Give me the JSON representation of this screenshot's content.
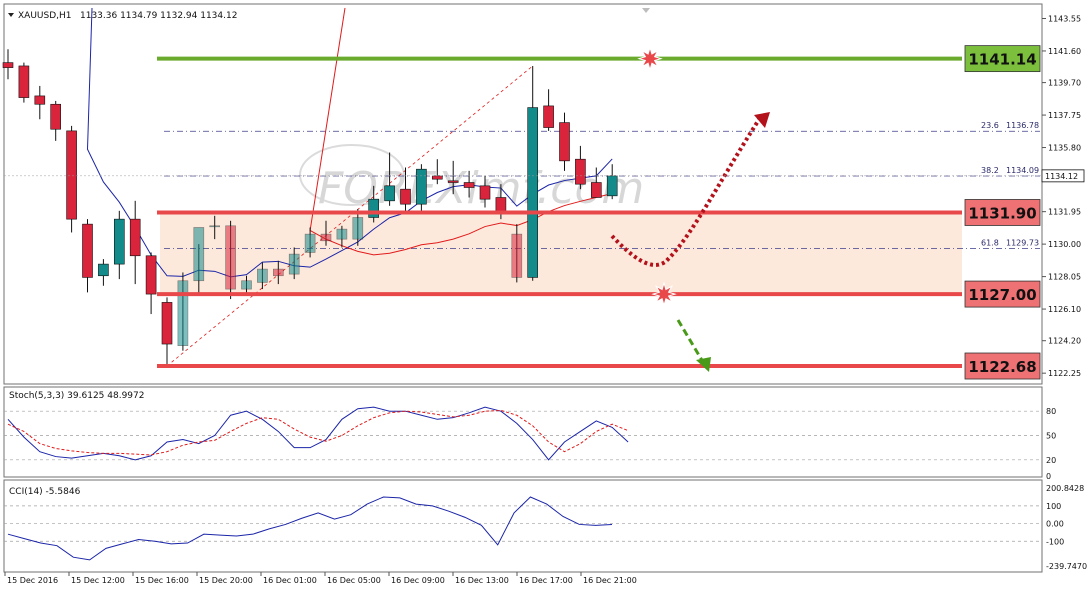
{
  "header": {
    "symbol": "XAUUSD,H1",
    "ohlc": "1133.36 1134.79 1132.94 1134.12"
  },
  "watermark": "FOREXimf.com",
  "colors": {
    "bull_candle": "#138b8b",
    "bear_candle": "#d9243c",
    "resistance_green": "#6aab2e",
    "support_red": "#e8484a",
    "zone_fill": "#fde9dc",
    "ma_blue": "#1b25a8",
    "ma_red": "#e11b1b",
    "stoch_main": "#1b25a8",
    "stoch_signal": "#e11b1b",
    "cci_line": "#1b25a8",
    "arrow_up": "#b3121b",
    "arrow_down": "#4a9a1a"
  },
  "chart_data": [
    {
      "type": "candlestick",
      "title": "XAUUSD,H1",
      "ohlc_last": [
        1133.36,
        1134.79,
        1132.94,
        1134.12
      ],
      "current_price_label": "1134.12",
      "ylim": [
        1121.6,
        1144.3
      ],
      "y_ticks": [
        "1143.55",
        "1141.60",
        "1139.70",
        "1137.75",
        "1135.80",
        "1133.90",
        "1131.95",
        "1130.00",
        "1128.05",
        "1126.10",
        "1124.20",
        "1122.25"
      ],
      "x_ticks": [
        "15 Dec 2016",
        "15 Dec 12:00",
        "15 Dec 16:00",
        "15 Dec 20:00",
        "16 Dec 01:00",
        "16 Dec 05:00",
        "16 Dec 09:00",
        "16 Dec 13:00",
        "16 Dec 17:00",
        "16 Dec 21:00"
      ],
      "candles": [
        {
          "o": 1140.9,
          "h": 1141.7,
          "l": 1139.9,
          "c": 1140.6
        },
        {
          "o": 1140.7,
          "h": 1140.9,
          "l": 1138.5,
          "c": 1138.8
        },
        {
          "o": 1138.9,
          "h": 1139.5,
          "l": 1137.5,
          "c": 1138.4
        },
        {
          "o": 1138.4,
          "h": 1138.6,
          "l": 1136.2,
          "c": 1136.9
        },
        {
          "o": 1136.8,
          "h": 1137.1,
          "l": 1130.7,
          "c": 1131.5
        },
        {
          "o": 1131.2,
          "h": 1131.5,
          "l": 1127.1,
          "c": 1128.0
        },
        {
          "o": 1128.1,
          "h": 1129.1,
          "l": 1127.5,
          "c": 1128.8
        },
        {
          "o": 1128.8,
          "h": 1132.0,
          "l": 1127.9,
          "c": 1131.5
        },
        {
          "o": 1131.5,
          "h": 1132.6,
          "l": 1127.6,
          "c": 1129.3
        },
        {
          "o": 1129.3,
          "h": 1129.5,
          "l": 1125.8,
          "c": 1127.0
        },
        {
          "o": 1126.5,
          "h": 1126.8,
          "l": 1122.7,
          "c": 1124.0
        },
        {
          "o": 1123.9,
          "h": 1128.3,
          "l": 1123.6,
          "c": 1127.8
        },
        {
          "o": 1127.8,
          "h": 1130.0,
          "l": 1126.9,
          "c": 1131.0
        },
        {
          "o": 1131.1,
          "h": 1131.7,
          "l": 1130.3,
          "c": 1131.1
        },
        {
          "o": 1131.1,
          "h": 1131.4,
          "l": 1126.7,
          "c": 1127.3
        },
        {
          "o": 1127.3,
          "h": 1128.1,
          "l": 1126.9,
          "c": 1127.8
        },
        {
          "o": 1127.7,
          "h": 1128.9,
          "l": 1127.3,
          "c": 1128.5
        },
        {
          "o": 1128.5,
          "h": 1129.0,
          "l": 1127.6,
          "c": 1128.1
        },
        {
          "o": 1128.2,
          "h": 1129.8,
          "l": 1127.9,
          "c": 1129.4
        },
        {
          "o": 1129.5,
          "h": 1131.0,
          "l": 1129.2,
          "c": 1130.6
        },
        {
          "o": 1130.6,
          "h": 1131.4,
          "l": 1129.9,
          "c": 1130.2
        },
        {
          "o": 1130.3,
          "h": 1131.1,
          "l": 1129.8,
          "c": 1130.9
        },
        {
          "o": 1130.3,
          "h": 1132.1,
          "l": 1129.9,
          "c": 1131.6
        },
        {
          "o": 1131.6,
          "h": 1133.5,
          "l": 1131.3,
          "c": 1132.7
        },
        {
          "o": 1132.6,
          "h": 1135.5,
          "l": 1132.3,
          "c": 1133.5
        },
        {
          "o": 1133.3,
          "h": 1134.6,
          "l": 1131.9,
          "c": 1132.4
        },
        {
          "o": 1132.4,
          "h": 1134.8,
          "l": 1132.0,
          "c": 1134.5
        },
        {
          "o": 1134.1,
          "h": 1135.1,
          "l": 1133.6,
          "c": 1133.9
        },
        {
          "o": 1133.8,
          "h": 1135.0,
          "l": 1133.0,
          "c": 1133.7
        },
        {
          "o": 1133.7,
          "h": 1134.4,
          "l": 1132.8,
          "c": 1133.4
        },
        {
          "o": 1133.5,
          "h": 1134.1,
          "l": 1132.2,
          "c": 1132.7
        },
        {
          "o": 1132.8,
          "h": 1133.6,
          "l": 1131.5,
          "c": 1132.0
        },
        {
          "o": 1130.6,
          "h": 1131.2,
          "l": 1127.7,
          "c": 1128.0
        },
        {
          "o": 1128.0,
          "h": 1140.7,
          "l": 1127.8,
          "c": 1138.2
        },
        {
          "o": 1138.3,
          "h": 1139.3,
          "l": 1136.8,
          "c": 1137.0
        },
        {
          "o": 1137.3,
          "h": 1137.9,
          "l": 1134.4,
          "c": 1135.0
        },
        {
          "o": 1135.1,
          "h": 1135.9,
          "l": 1133.3,
          "c": 1133.6
        },
        {
          "o": 1133.7,
          "h": 1134.6,
          "l": 1132.9,
          "c": 1132.8
        },
        {
          "o": 1132.9,
          "h": 1134.8,
          "l": 1132.7,
          "c": 1134.1
        }
      ],
      "levels": [
        {
          "value": 1141.14,
          "label": "1141.14",
          "kind": "resistance"
        },
        {
          "value": 1131.9,
          "label": "1131.90",
          "kind": "support"
        },
        {
          "value": 1127.0,
          "label": "1127.00",
          "kind": "support"
        },
        {
          "value": 1122.68,
          "label": "1122.68",
          "kind": "support"
        }
      ],
      "fibonacci": [
        {
          "level": "23.6",
          "price": "1136.78",
          "value": 1136.78
        },
        {
          "level": "38.2",
          "price": "1134.09",
          "value": 1134.09
        },
        {
          "level": "61.8",
          "price": "1129.73",
          "value": 1129.73
        }
      ],
      "grid": false,
      "zone": [
        1127.0,
        1131.9
      ]
    },
    {
      "type": "line",
      "title": "Stoch(5,3,3) 39.6125 48.9972",
      "ylim": [
        0,
        100
      ],
      "y_ticks": [
        "80",
        "50",
        "20",
        "0"
      ],
      "series": [
        {
          "values": [
            70,
            48,
            30,
            24,
            22,
            25,
            28,
            25,
            20,
            25,
            42,
            45,
            40,
            50,
            75,
            80,
            70,
            55,
            35,
            35,
            45,
            70,
            83,
            85,
            80,
            80,
            75,
            70,
            72,
            78,
            85,
            80,
            65,
            45,
            20,
            42,
            55,
            68,
            60,
            42
          ]
        },
        {
          "values": [
            64,
            55,
            40,
            34,
            31,
            29,
            28,
            28,
            27,
            26,
            30,
            38,
            42,
            44,
            55,
            65,
            72,
            70,
            58,
            48,
            43,
            50,
            62,
            72,
            78,
            80,
            79,
            76,
            73,
            75,
            80,
            81,
            75,
            62,
            42,
            30,
            40,
            55,
            64,
            56
          ]
        }
      ]
    },
    {
      "type": "line",
      "title": "CCI(14) -5.5846",
      "ylim": [
        -239.747,
        200.8428
      ],
      "y_ticks": [
        "200.8428",
        "100",
        "0.00",
        "-100",
        "-239.7470"
      ],
      "series": [
        {
          "values": [
            -60,
            -85,
            -110,
            -125,
            -190,
            -205,
            -140,
            -115,
            -90,
            -100,
            -115,
            -110,
            -60,
            -65,
            -70,
            -60,
            -30,
            -5,
            30,
            60,
            25,
            50,
            110,
            150,
            145,
            110,
            100,
            70,
            35,
            -10,
            -120,
            60,
            150,
            110,
            40,
            -5,
            -10,
            -5
          ]
        }
      ]
    }
  ]
}
